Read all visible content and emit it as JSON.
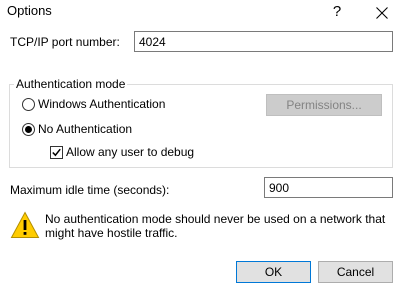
{
  "window": {
    "title": "Options",
    "help_glyph": "?",
    "close_icon": "close-icon"
  },
  "port": {
    "label": "TCP/IP port number:",
    "value": "4024"
  },
  "auth": {
    "group_label": "Authentication mode",
    "windows_label": "Windows Authentication",
    "windows_selected": false,
    "permissions_label": "Permissions...",
    "permissions_enabled": false,
    "none_label": "No Authentication",
    "none_selected": true,
    "allow_debug_label": "Allow any user to debug",
    "allow_debug_checked": true
  },
  "idle": {
    "label": "Maximum idle time (seconds):",
    "value": "900"
  },
  "warning": {
    "icon": "warning-icon",
    "text": "No authentication mode should never be used on a network that might have hostile traffic."
  },
  "buttons": {
    "ok_label": "OK",
    "cancel_label": "Cancel"
  },
  "colors": {
    "default_button_border": "#0078d7",
    "warning_fill": "#ffcc00"
  }
}
